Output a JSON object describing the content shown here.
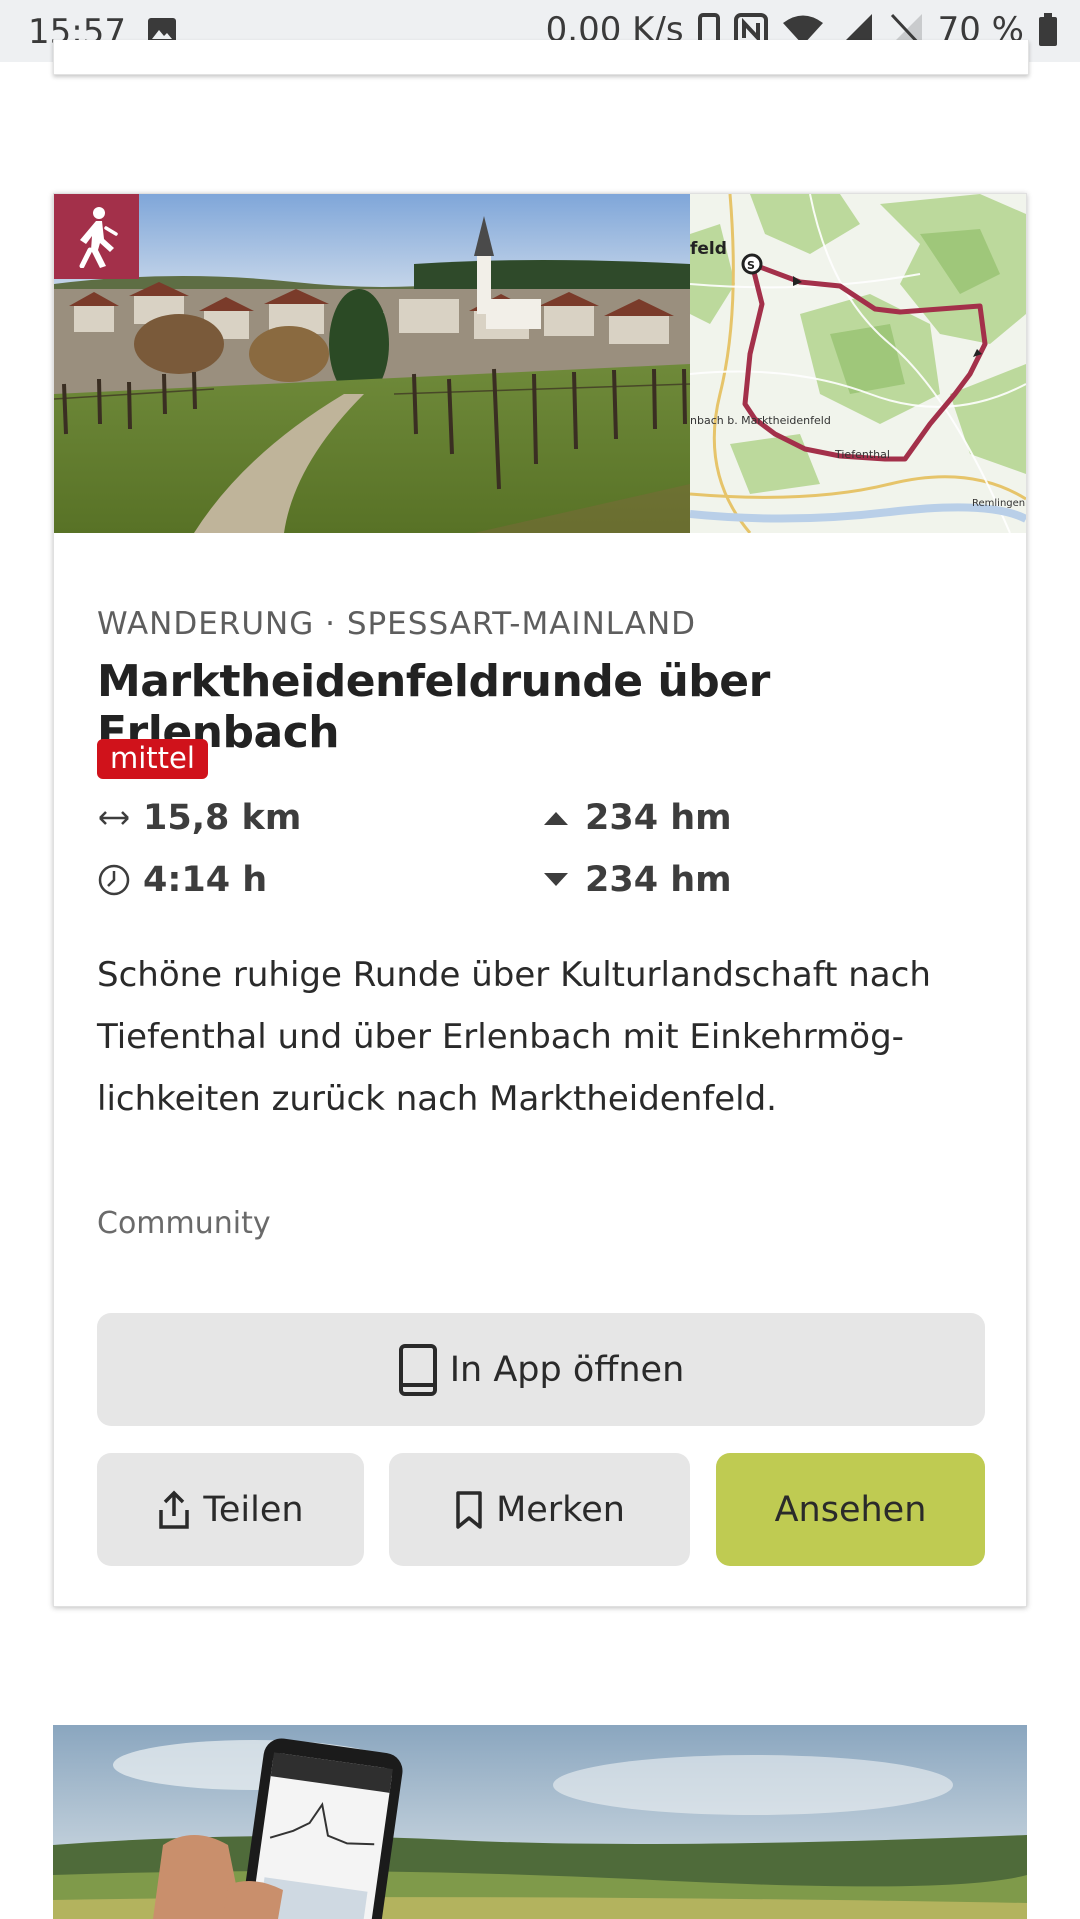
{
  "status_bar": {
    "time": "15:57",
    "network_speed": "0.00 K/s",
    "battery": "70 %",
    "icons": [
      "gallery-icon",
      "phone-icon",
      "nfc-icon",
      "wifi-icon",
      "signal-icon",
      "no-sim-icon",
      "battery-icon"
    ]
  },
  "card": {
    "category": "WANDERUNG · SPESSART-MAINLAND",
    "title": "Marktheidenfeldrunde über Erlenbach",
    "difficulty": "mittel",
    "difficulty_color": "#d0121b",
    "badge_color": "#a3304a",
    "stats": {
      "distance": "15,8 km",
      "ascent": "234 hm",
      "duration": "4:14 h",
      "descent": "234 hm"
    },
    "description": "Schöne ruhige Runde über Kulturlandschaft nach Tiefenthal und über Erlenbach mit Einkehrmög-lichkeiten zurück nach Marktheidenfeld.",
    "source": "Community",
    "map_labels": {
      "top_left": "feld",
      "start_marker": "S",
      "town": "nbach b. Marktheidenfeld",
      "village": "Tiefenthal",
      "corner": "Remlingen"
    },
    "buttons": {
      "open_in_app": "In App öffnen",
      "share": "Teilen",
      "save": "Merken",
      "view": "Ansehen"
    },
    "accent_color": "#bfcb52"
  }
}
